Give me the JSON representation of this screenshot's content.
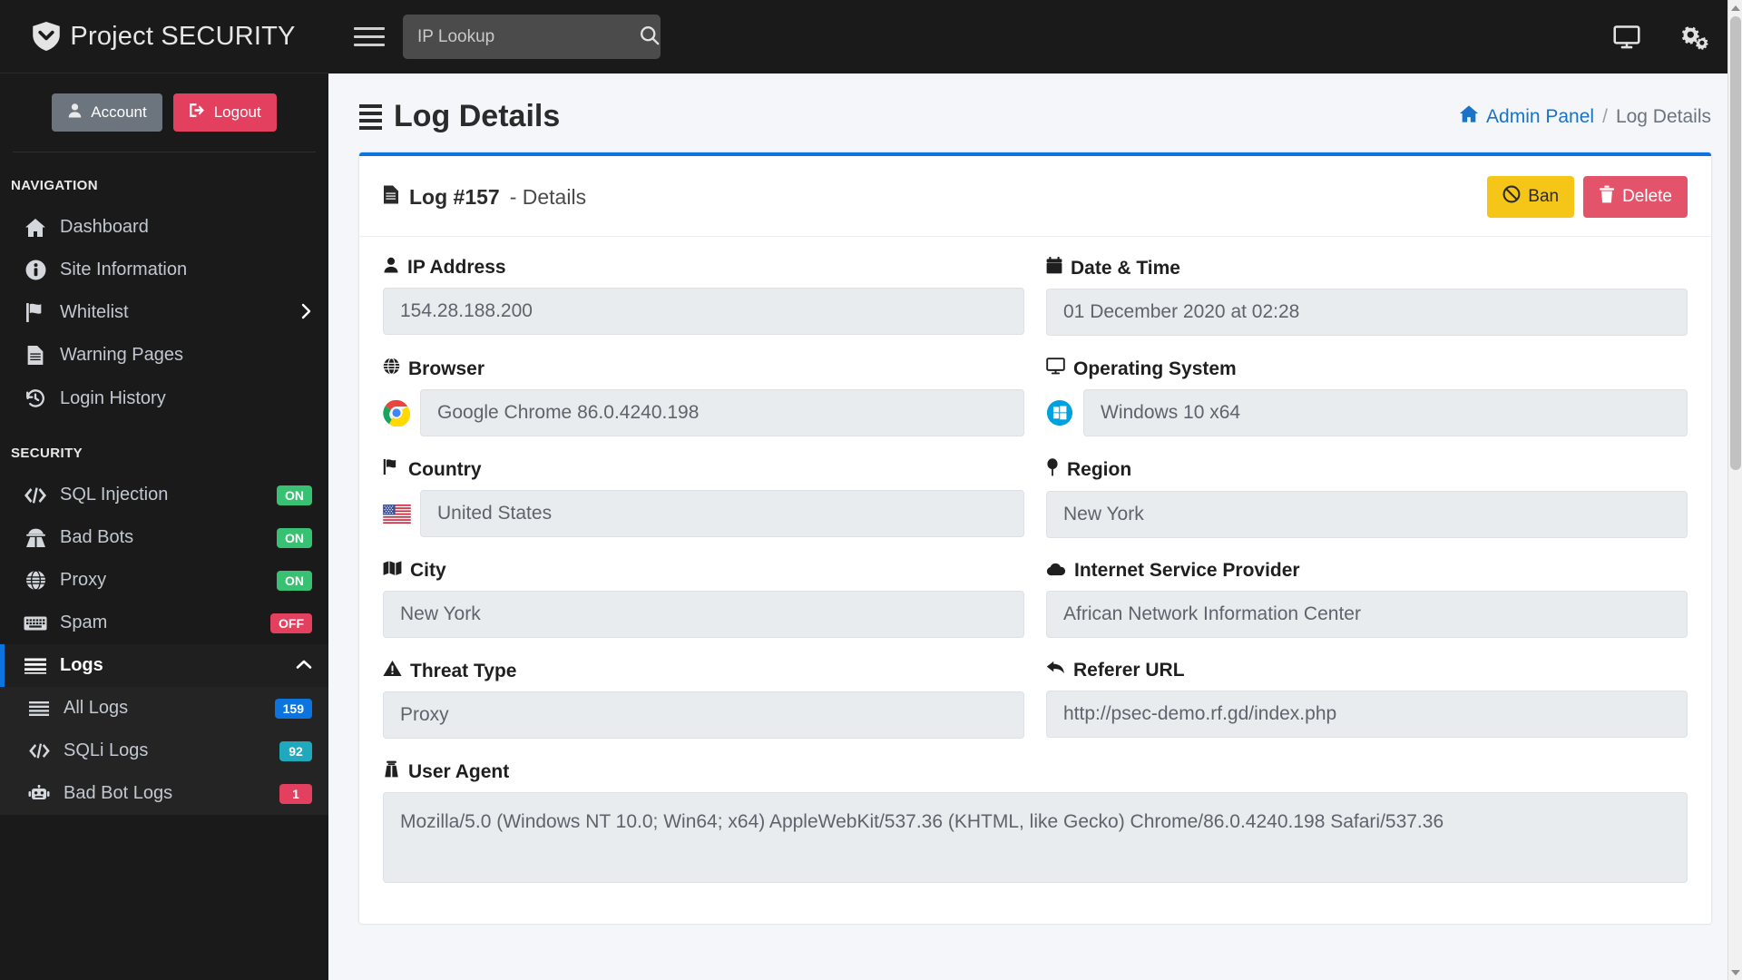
{
  "brand": {
    "title": "Project SECURITY",
    "icon": "shield-check-icon"
  },
  "sidebar": {
    "account_button": "Account",
    "logout_button": "Logout",
    "sections": [
      {
        "header": "NAVIGATION",
        "items": [
          {
            "label": "Dashboard",
            "icon": "home-icon",
            "badge": null,
            "active": false
          },
          {
            "label": "Site Information",
            "icon": "info-circle-icon",
            "badge": null,
            "active": false
          },
          {
            "label": "Whitelist",
            "icon": "flag-icon",
            "badge": null,
            "active": false,
            "chevron": "chevron-right-icon"
          },
          {
            "label": "Warning Pages",
            "icon": "file-lines-icon",
            "badge": null,
            "active": false
          },
          {
            "label": "Login History",
            "icon": "history-icon",
            "badge": null,
            "active": false
          }
        ]
      },
      {
        "header": "SECURITY",
        "items": [
          {
            "label": "SQL Injection",
            "icon": "code-icon",
            "badge": "ON",
            "badge_style": "on",
            "active": false
          },
          {
            "label": "Bad Bots",
            "icon": "user-secret-icon",
            "badge": "ON",
            "badge_style": "on",
            "active": false
          },
          {
            "label": "Proxy",
            "icon": "globe-icon",
            "badge": "ON",
            "badge_style": "on",
            "active": false
          },
          {
            "label": "Spam",
            "icon": "keyboard-icon",
            "badge": "OFF",
            "badge_style": "off",
            "active": false
          },
          {
            "label": "Logs",
            "icon": "bars-icon",
            "badge": null,
            "chevron": "chevron-up-icon",
            "active": true
          },
          {
            "label": "All Logs",
            "icon": "bars-icon",
            "badge": "159",
            "badge_style": "blue",
            "sub": true
          },
          {
            "label": "SQLi Logs",
            "icon": "code-icon",
            "badge": "92",
            "badge_style": "cyan",
            "sub": true
          },
          {
            "label": "Bad Bot Logs",
            "icon": "robot-icon",
            "badge": "1",
            "badge_style": "red",
            "sub": true
          }
        ]
      }
    ]
  },
  "topbar": {
    "menu_toggle": "hamburger-icon",
    "search_placeholder": "IP Lookup",
    "search_value": "",
    "search_icon": "search-icon",
    "right_icons": [
      {
        "name": "desktop-icon"
      },
      {
        "name": "gears-icon"
      }
    ]
  },
  "page": {
    "title": "Log Details",
    "title_icon": "bars-icon",
    "breadcrumb": {
      "home_icon": "home-icon",
      "home_label": "Admin Panel",
      "separator": "/",
      "current": "Log Details"
    }
  },
  "card": {
    "icon": "file-lines-icon",
    "title_strong": "Log #157",
    "title_rest": "- Details",
    "ban_button": "Ban",
    "ban_icon": "ban-icon",
    "delete_button": "Delete",
    "delete_icon": "trash-icon",
    "fields": [
      {
        "label": "IP Address",
        "icon": "user-icon",
        "value": "154.28.188.200",
        "leading": null
      },
      {
        "label": "Date & Time",
        "icon": "calendar-icon",
        "value": "01 December 2020 at 02:28",
        "leading": null
      },
      {
        "label": "Browser",
        "icon": "globe-icon",
        "value": "Google Chrome 86.0.4240.198",
        "leading": "chrome-logo-icon"
      },
      {
        "label": "Operating System",
        "icon": "desktop-icon",
        "value": "Windows 10 x64",
        "leading": "windows-logo-icon"
      },
      {
        "label": "Country",
        "icon": "flag-icon",
        "value": "United States",
        "leading": "us-flag-icon"
      },
      {
        "label": "Region",
        "icon": "map-marker-icon",
        "value": "New York",
        "leading": null
      },
      {
        "label": "City",
        "icon": "map-icon",
        "value": "New York",
        "leading": null
      },
      {
        "label": "Internet Service Provider",
        "icon": "cloud-icon",
        "value": "African Network Information Center",
        "leading": null
      },
      {
        "label": "Threat Type",
        "icon": "warning-triangle-icon",
        "value": "Proxy",
        "leading": null
      },
      {
        "label": "Referer URL",
        "icon": "reply-arrow-icon",
        "value": "http://psec-demo.rf.gd/index.php",
        "leading": null
      }
    ],
    "user_agent": {
      "label": "User Agent",
      "icon": "user-agent-icon",
      "value": "Mozilla/5.0 (Windows NT 10.0; Win64; x64) AppleWebKit/537.36 (KHTML, like Gecko) Chrome/86.0.4240.198 Safari/537.36"
    }
  },
  "colors": {
    "accent_blue": "#0b74de",
    "sidebar_bg": "#1a1a1a",
    "ban_yellow": "#f5c518",
    "delete_red": "#e3546a",
    "badge_on": "#38c172",
    "badge_off": "#e3405f"
  }
}
